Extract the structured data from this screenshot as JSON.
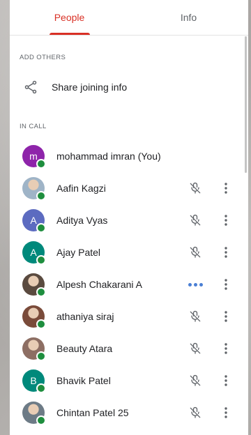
{
  "tabs": [
    {
      "label": "People",
      "active": true
    },
    {
      "label": "Info",
      "active": false
    }
  ],
  "add_others": {
    "section_label": "ADD OTHERS",
    "share_label": "Share joining info"
  },
  "in_call": {
    "section_label": "IN CALL",
    "participants": [
      {
        "name": "mohammad imran (You)",
        "avatar_type": "letter",
        "initial": "m",
        "avatar_color": "#8e24aa",
        "status": "none"
      },
      {
        "name": "Aafin Kagzi",
        "avatar_type": "photo",
        "avatar_color": "#9fb4c7",
        "status": "muted"
      },
      {
        "name": "Aditya Vyas",
        "avatar_type": "letter",
        "initial": "A",
        "avatar_color": "#5c6bc0",
        "status": "muted"
      },
      {
        "name": "Ajay Patel",
        "avatar_type": "letter",
        "initial": "A",
        "avatar_color": "#00897b",
        "status": "muted"
      },
      {
        "name": "Alpesh Chakarani A",
        "avatar_type": "photo",
        "avatar_color": "#5a4a3f",
        "status": "speaking"
      },
      {
        "name": "athaniya siraj",
        "avatar_type": "photo",
        "avatar_color": "#7a4b3a",
        "status": "muted"
      },
      {
        "name": "Beauty Atara",
        "avatar_type": "photo",
        "avatar_color": "#8d6e63",
        "status": "muted"
      },
      {
        "name": "Bhavik Patel",
        "avatar_type": "letter",
        "initial": "B",
        "avatar_color": "#00897b",
        "status": "muted"
      },
      {
        "name": "Chintan Patel 25",
        "avatar_type": "photo",
        "avatar_color": "#6d7b86",
        "status": "muted"
      }
    ]
  },
  "colors": {
    "accent": "#d93025",
    "presence": "#1e8e3e",
    "speaking": "#4a7fd4"
  },
  "icons": {
    "share": "share-icon",
    "muted": "mic-off-icon",
    "more": "more-vert-icon",
    "speaking": "speaking-indicator-icon"
  }
}
